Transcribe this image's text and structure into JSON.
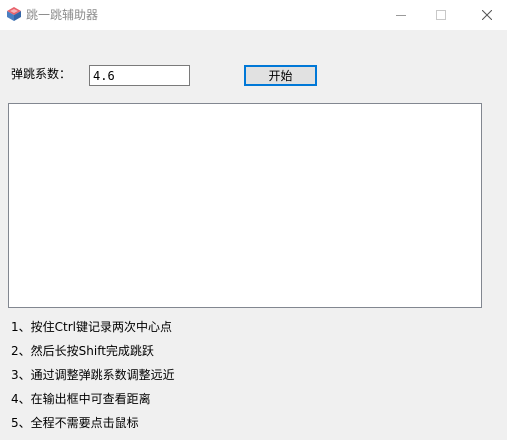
{
  "window": {
    "title": "跳一跳辅助器",
    "icon": "app-icon"
  },
  "controls": {
    "factor_label": "弹跳系数：",
    "factor_value": "4.6",
    "start_label": "开始",
    "output_text": ""
  },
  "instructions": [
    "1、按住Ctrl键记录两次中心点",
    "2、然后长按Shift完成跳跃",
    "3、通过调整弹跳系数调整远近",
    "4、在输出框中可查看距离",
    "5、全程不需要点击鼠标"
  ],
  "colors": {
    "accent": "#0078d7",
    "background": "#f0f0f0",
    "title_text": "#8c8c8c"
  }
}
